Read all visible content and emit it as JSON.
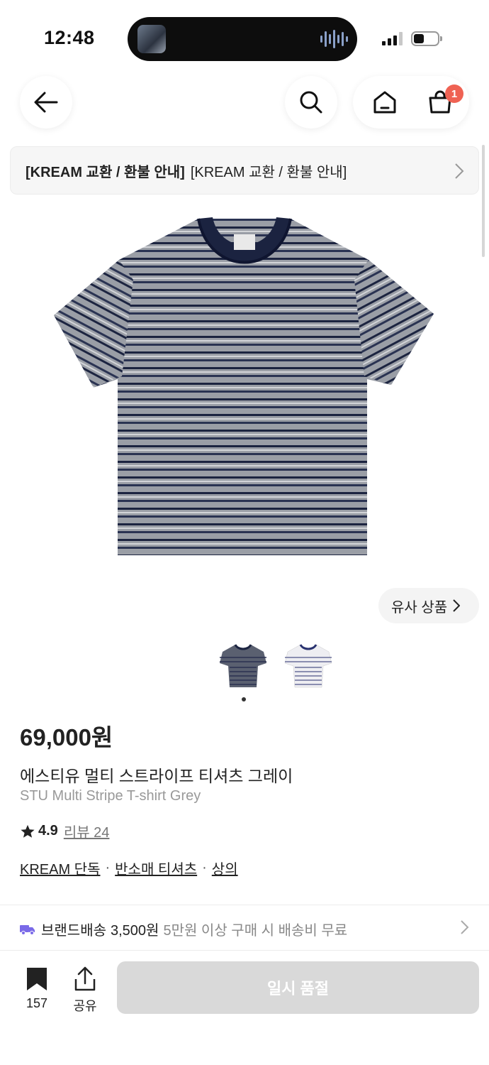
{
  "status_bar": {
    "time": "12:48"
  },
  "header": {
    "cart_count": "1"
  },
  "notice": {
    "bold": "[KREAM 교환 / 환불 안내]",
    "text": "[KREAM 교환 / 환불 안내]"
  },
  "similar": {
    "label": "유사 상품"
  },
  "product": {
    "price": "69,000원",
    "name_ko": "에스티유 멀티 스트라이프 티셔츠 그레이",
    "name_en": "STU Multi Stripe T-shirt Grey",
    "rating": "4.9",
    "review_label": "리뷰 24",
    "tags": [
      "KREAM 단독",
      "반소매 티셔츠",
      "상의"
    ],
    "colors": {
      "body_grey": "#9a9ea6",
      "stripe_navy": "#1c2440",
      "collar_navy": "#1b2340"
    }
  },
  "delivery": {
    "label": "브랜드배송",
    "fee": "3,500원",
    "note": "5만원 이상 구매 시 배송비 무료"
  },
  "bottom": {
    "bookmark_count": "157",
    "share_label": "공유",
    "cta_label": "일시 품절"
  },
  "icons": [
    "back-arrow-icon",
    "search-icon",
    "home-icon",
    "cart-icon",
    "chevron-right-icon",
    "star-icon",
    "truck-icon",
    "bookmark-icon",
    "share-icon"
  ]
}
